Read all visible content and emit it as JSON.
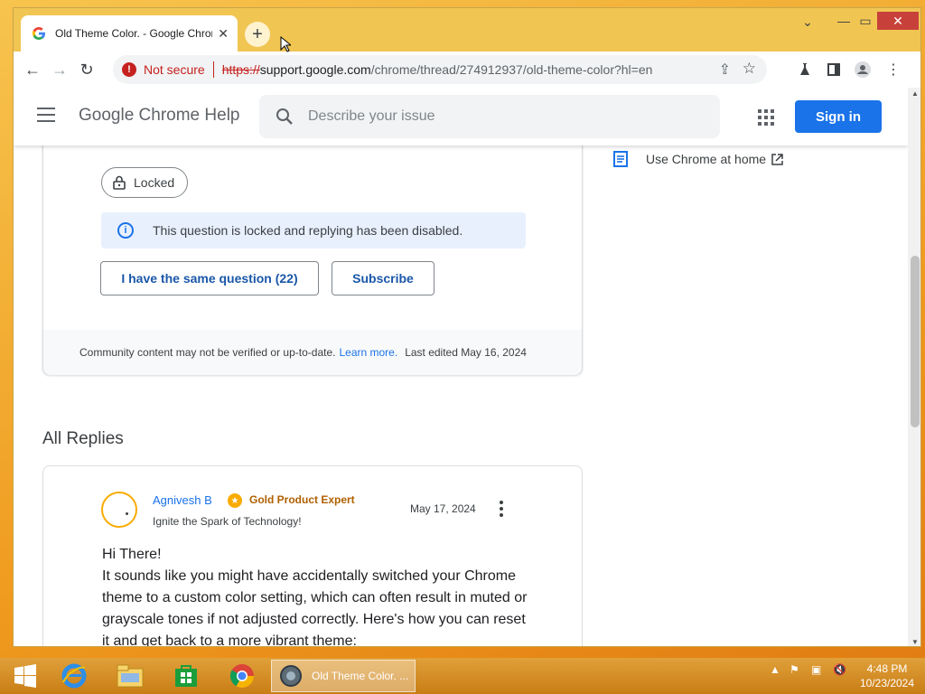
{
  "browser": {
    "tab_title": "Old Theme Color. - Google Chrome",
    "new_tab_label": "+",
    "omnibox": {
      "security_label": "Not secure",
      "url_scheme": "https://",
      "url_host": "support.google.com",
      "url_path": "/chrome/thread/274912937/old-theme-color?hl=en"
    }
  },
  "header": {
    "product_name": "Google Chrome Help",
    "search_placeholder": "Describe your issue",
    "signin_label": "Sign in"
  },
  "question": {
    "locked_label": "Locked",
    "notice_text": "This question is locked and replying has been disabled.",
    "same_question_label": "I have the same question (22)",
    "subscribe_label": "Subscribe",
    "footer_text": "Community content may not be verified or up-to-date.",
    "footer_link": "Learn more.",
    "footer_edited": "Last edited May 16, 2024"
  },
  "sidebar": {
    "link_label": "Use Chrome at home"
  },
  "replies": {
    "heading": "All Replies",
    "items": [
      {
        "author": "Agnivesh B",
        "badge": "Gold Product Expert",
        "tagline": "Ignite the Spark of Technology!",
        "date": "May 17, 2024",
        "body": [
          "Hi There!",
          "It sounds like you might have accidentally switched your Chrome theme to a custom color setting, which can often result in muted or grayscale tones if not adjusted correctly. Here's how you can reset it and get back to a more vibrant theme:"
        ]
      }
    ]
  },
  "taskbar": {
    "active_window_label": "Old Theme Color. ...",
    "clock_time": "4:48 PM",
    "clock_date": "10/23/2024"
  },
  "colors": {
    "accent": "#1a73e8",
    "window_frame": "#f0c552",
    "danger": "#c5221f",
    "gold_badge": "#f9ab00"
  }
}
